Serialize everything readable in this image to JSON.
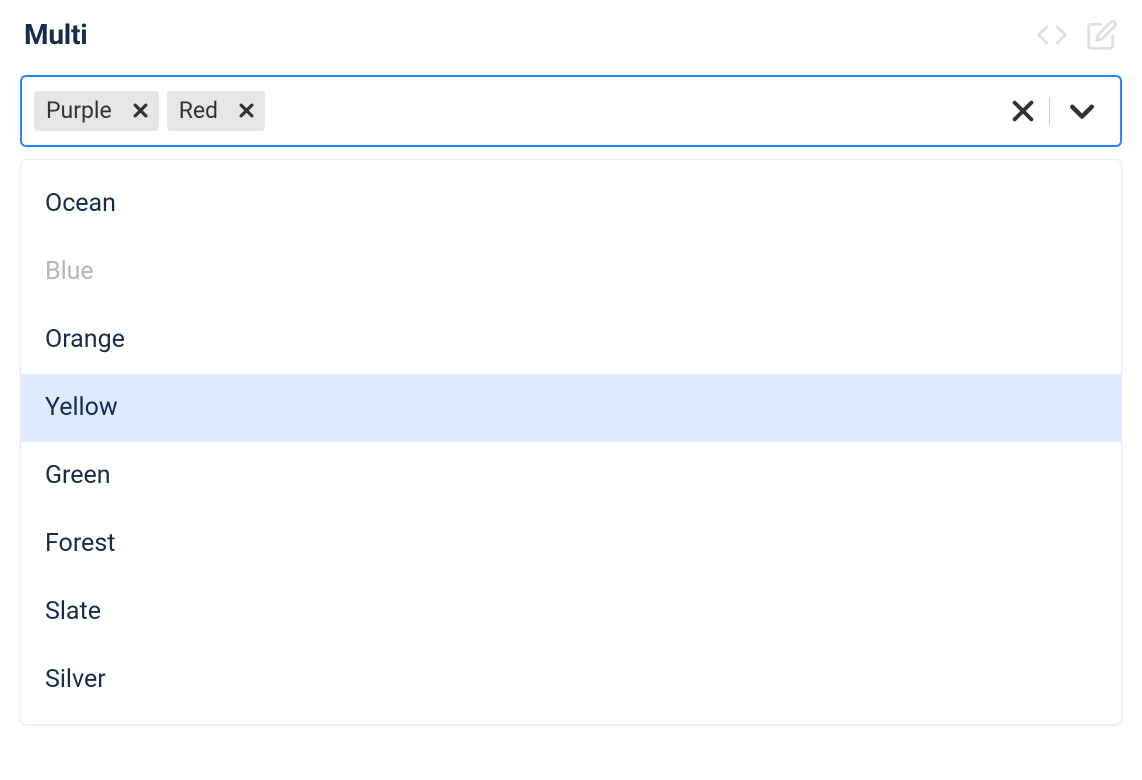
{
  "title": "Multi",
  "colors": {
    "focus_border": "#2684FF",
    "tag_bg": "#e6e6e6",
    "text": "#172B4D",
    "option_highlight_bg": "#DEEBFF",
    "disabled_text": "#b3b7c0",
    "indicator": "#333333"
  },
  "select": {
    "selected": [
      {
        "label": "Purple"
      },
      {
        "label": "Red"
      }
    ],
    "options": [
      {
        "label": "Ocean",
        "disabled": false,
        "highlighted": false
      },
      {
        "label": "Blue",
        "disabled": true,
        "highlighted": false
      },
      {
        "label": "Orange",
        "disabled": false,
        "highlighted": false
      },
      {
        "label": "Yellow",
        "disabled": false,
        "highlighted": true
      },
      {
        "label": "Green",
        "disabled": false,
        "highlighted": false
      },
      {
        "label": "Forest",
        "disabled": false,
        "highlighted": false
      },
      {
        "label": "Slate",
        "disabled": false,
        "highlighted": false
      },
      {
        "label": "Silver",
        "disabled": false,
        "highlighted": false
      }
    ]
  }
}
